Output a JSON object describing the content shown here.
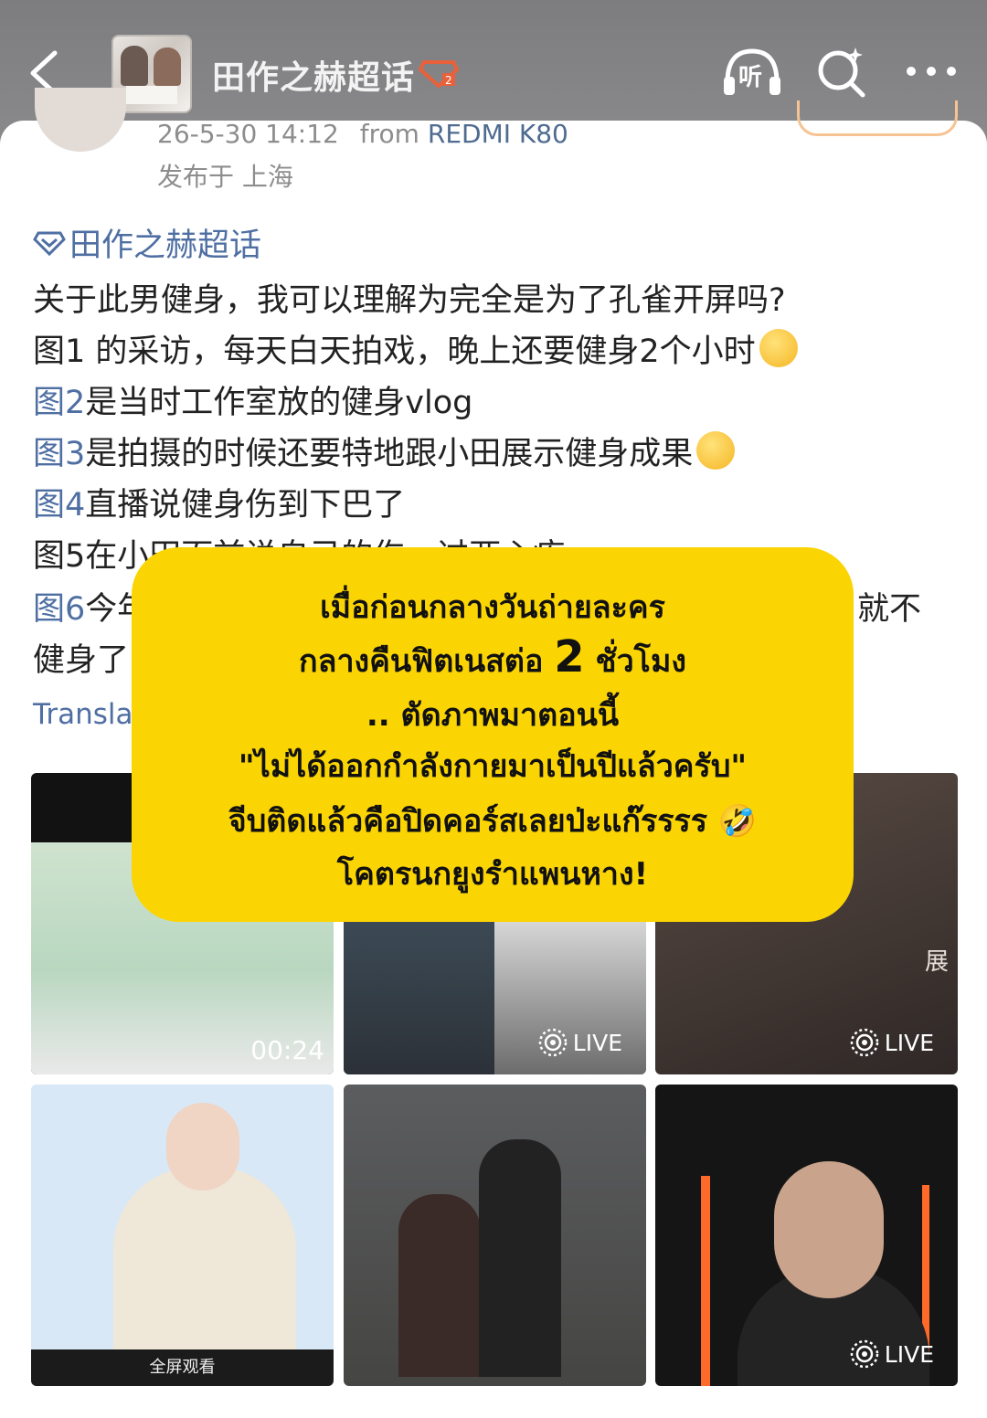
{
  "header": {
    "title": "田作之赫超话",
    "listen_label": "听",
    "icons": [
      "back-icon",
      "cover-image",
      "badge-icon",
      "listen-icon",
      "search-icon",
      "more-icon"
    ]
  },
  "post": {
    "meta_time": "26-5-30 14:12",
    "meta_from": "from",
    "meta_device": "REDMI K80",
    "location": "发布于 上海",
    "topic": "田作之赫超话",
    "lines": [
      "关于此男健身，我可以理解为完全是为了孔雀开屏吗?",
      "图1 的采访，每天白天拍戏，晚上还要健身2个小时",
      "是当时工作室放的健身vlog",
      "是拍摄的时候还要特地跟小田展示健身成果",
      "直播说健身伤到下巴了",
      "图5在小田面前说自己的伤，过两心疼",
      "今年",
      "就不",
      "健身了"
    ],
    "links": [
      "图2",
      "图3",
      "图4",
      "图6"
    ],
    "translate": "Translate"
  },
  "media": {
    "duration": "00:24",
    "live_label": "LIVE",
    "t4_bar": "全屏观看",
    "t3_char": "展"
  },
  "overlay": {
    "line1": "เมื่อก่อนกลางวันถ่ายละคร",
    "line2a": "กลางคืนฟิตเนสต่อ ",
    "line2b": "2",
    "line2c": " ชั่วโมง",
    "line3": ".. ตัดภาพมาตอนนี้",
    "line4": "\"ไม่ได้ออกกำลังกายมาเป็นปีแล้วครับ\"",
    "line5": "จีบติดแล้วคือปิดคอร์สเลยป่ะแก๊รรรร 🤣",
    "line6": "โคตรนกยูงรำแพนหาง!"
  }
}
